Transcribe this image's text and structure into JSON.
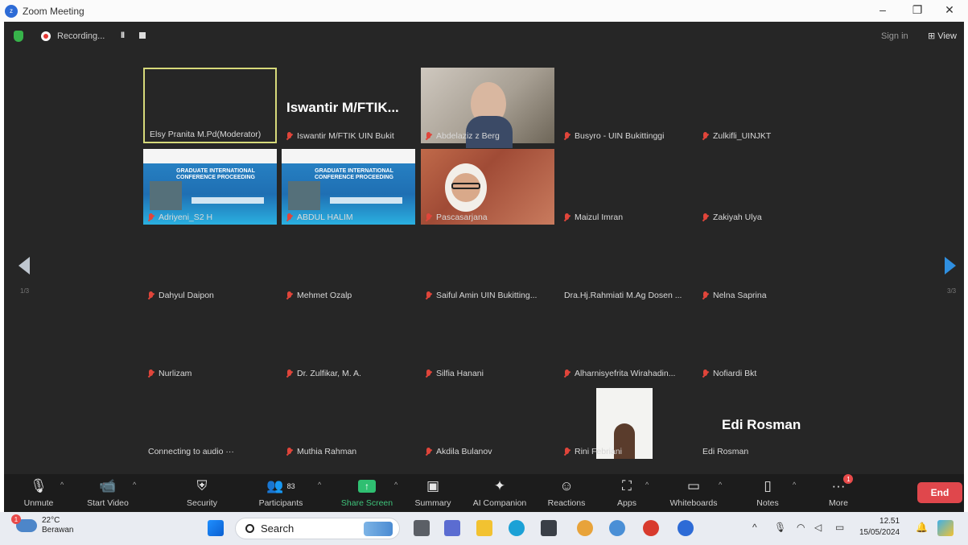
{
  "window": {
    "title": "Zoom Meeting",
    "controls": [
      "–",
      "❐",
      "✕"
    ]
  },
  "meeting_topbar": {
    "recording_label": "Recording...",
    "pause_label": "II",
    "sign_in": "Sign in",
    "view_label": "View"
  },
  "tiles": [
    {
      "name": "Elsy Pranita M.Pd(Moderator)",
      "muted": false
    },
    {
      "name": "Iswantir M/FTIK UIN Bukit",
      "big": "Iswantir M/FTIK...",
      "muted": true
    },
    {
      "name": "Abdelaziz z Berg",
      "muted": true
    },
    {
      "name": "Busyro - UIN Bukittinggi",
      "muted": true
    },
    {
      "name": "Zulkifli_UINJKT",
      "muted": true
    },
    {
      "name": "Adriyeni_S2 H",
      "muted": true,
      "poster": "GRADUATE INTERNATIONAL CONFERENCE PROCEEDING"
    },
    {
      "name": "ABDUL HALIM",
      "muted": true,
      "poster": "GRADUATE INTERNATIONAL CONFERENCE PROCEEDING"
    },
    {
      "name": "Pascasarjana",
      "muted": true
    },
    {
      "name": "Maizul Imran",
      "muted": true
    },
    {
      "name": "Zakiyah Ulya",
      "muted": true
    },
    {
      "name": "Dahyul Daipon",
      "muted": true
    },
    {
      "name": "Mehmet Ozalp",
      "muted": true
    },
    {
      "name": "Saiful Amin UIN Bukitting...",
      "muted": true
    },
    {
      "name": "Dra.Hj.Rahmiati M.Ag Dosen ...",
      "muted": false
    },
    {
      "name": "Nelna Saprina",
      "muted": true
    },
    {
      "name": "Nurlizam",
      "muted": true
    },
    {
      "name": "Dr. Zulfikar, M. A.",
      "muted": true
    },
    {
      "name": "Silfia Hanani",
      "muted": true
    },
    {
      "name": "Alharnisyefrita Wirahadin...",
      "muted": true
    },
    {
      "name": "Nofiardi Bkt",
      "muted": true
    },
    {
      "name": "Connecting to audio ···",
      "muted": false
    },
    {
      "name": "Muthia Rahman",
      "muted": true
    },
    {
      "name": "Akdila Bulanov",
      "muted": true
    },
    {
      "name": "Rini Febriani",
      "muted": true
    },
    {
      "name": "Edi Rosman",
      "big": "Edi Rosman",
      "muted": false
    }
  ],
  "page_nav": {
    "left_page": "1/3",
    "right_page": "3/3"
  },
  "toolbar": {
    "unmute": "Unmute",
    "start_video": "Start Video",
    "security": "Security",
    "participants": "Participants",
    "participants_count": "83",
    "share_screen": "Share Screen",
    "summary": "Summary",
    "ai_companion": "AI Companion",
    "reactions": "Reactions",
    "apps": "Apps",
    "whiteboards": "Whiteboards",
    "notes": "Notes",
    "more": "More",
    "more_badge": "1",
    "end": "End"
  },
  "taskbar": {
    "temperature": "22°C",
    "weather": "Berawan",
    "weather_badge": "1",
    "search": "Search",
    "time": "12.51",
    "date": "15/05/2024"
  },
  "colors": {
    "meeting_bg": "#262626",
    "toolbar_bg": "#1c1c1c",
    "end_button": "#e0474c",
    "share_green": "#2fbf71",
    "active_speaker_border": "#d6d97a",
    "muted_mic": "#e0453a"
  }
}
